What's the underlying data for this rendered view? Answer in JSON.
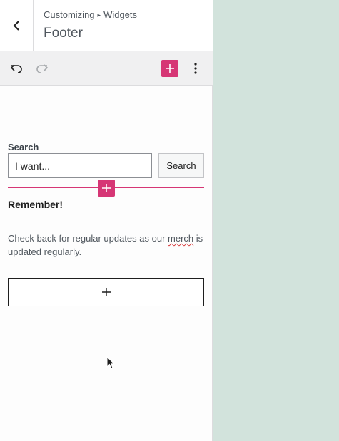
{
  "header": {
    "breadcrumb_parent": "Customizing",
    "breadcrumb_separator": "▸",
    "breadcrumb_child": "Widgets",
    "title": "Footer"
  },
  "toolbar": {
    "undo_icon": "undo-icon",
    "redo_icon": "redo-icon",
    "add_block_icon": "plus-icon",
    "options_icon": "vertical-ellipsis-icon",
    "accent_color": "#d63675"
  },
  "search_widget": {
    "label": "Search",
    "input_value": "I want...",
    "button_label": "Search"
  },
  "heading_block": {
    "text": "Remember!"
  },
  "paragraph_block": {
    "text_before": "Check back for regular updates as our ",
    "misspelled_word": "merch",
    "text_after": " is updated regularly."
  },
  "preview": {
    "background_color": "#d2e3dc"
  }
}
